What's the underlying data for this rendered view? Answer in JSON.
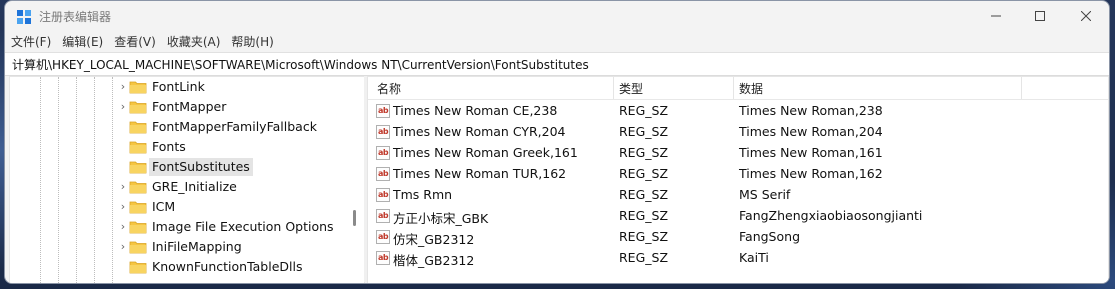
{
  "window": {
    "title": "注册表编辑器"
  },
  "menu": [
    "文件(F)",
    "编辑(E)",
    "查看(V)",
    "收藏夹(A)",
    "帮助(H)"
  ],
  "address": "计算机\\HKEY_LOCAL_MACHINE\\SOFTWARE\\Microsoft\\Windows NT\\CurrentVersion\\FontSubstitutes",
  "tree": {
    "items": [
      {
        "label": "FontLink",
        "expandable": true
      },
      {
        "label": "FontMapper",
        "expandable": true
      },
      {
        "label": "FontMapperFamilyFallback",
        "expandable": false
      },
      {
        "label": "Fonts",
        "expandable": false
      },
      {
        "label": "FontSubstitutes",
        "expandable": false,
        "selected": true
      },
      {
        "label": "GRE_Initialize",
        "expandable": true
      },
      {
        "label": "ICM",
        "expandable": true
      },
      {
        "label": "Image File Execution Options",
        "expandable": true
      },
      {
        "label": "IniFileMapping",
        "expandable": true
      },
      {
        "label": "KnownFunctionTableDlls",
        "expandable": false
      }
    ]
  },
  "list": {
    "columns": {
      "name": "名称",
      "type": "类型",
      "data": "数据"
    },
    "value_icon": "ab",
    "rows": [
      {
        "name": "Times New Roman CE,238",
        "type": "REG_SZ",
        "data": "Times New Roman,238"
      },
      {
        "name": "Times New Roman CYR,204",
        "type": "REG_SZ",
        "data": "Times New Roman,204"
      },
      {
        "name": "Times New Roman Greek,161",
        "type": "REG_SZ",
        "data": "Times New Roman,161"
      },
      {
        "name": "Times New Roman TUR,162",
        "type": "REG_SZ",
        "data": "Times New Roman,162"
      },
      {
        "name": "Tms Rmn",
        "type": "REG_SZ",
        "data": "MS Serif"
      },
      {
        "name": "方正小标宋_GBK",
        "type": "REG_SZ",
        "data": "FangZhengxiaobiaosongjianti"
      },
      {
        "name": "仿宋_GB2312",
        "type": "REG_SZ",
        "data": "FangSong"
      },
      {
        "name": "楷体_GB2312",
        "type": "REG_SZ",
        "data": "KaiTi"
      }
    ]
  },
  "colors": {
    "folder": "#f5c543",
    "selection": "#e4e4e4",
    "icon_blue": "#1e74d9"
  }
}
